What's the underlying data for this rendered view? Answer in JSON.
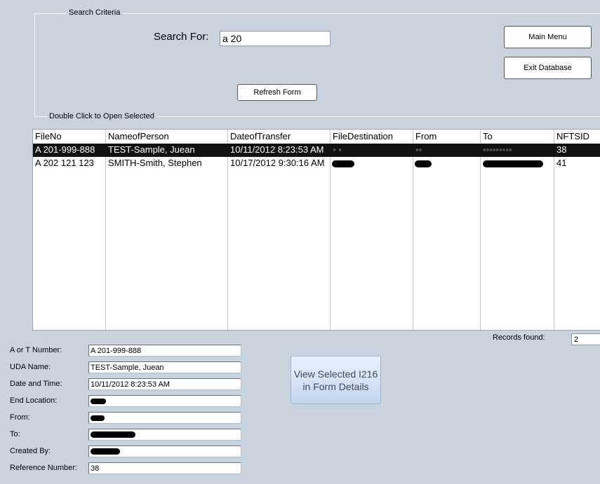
{
  "search": {
    "group_title": "Search Criteria",
    "label": "Search For:",
    "value": "a 20",
    "refresh_label": "Refresh Form"
  },
  "buttons": {
    "main_menu": "Main Menu",
    "exit_database": "Exit Database"
  },
  "list": {
    "caption": "Double Click to Open Selected",
    "columns": [
      "FileNo",
      "NameofPerson",
      "DateofTransfer",
      "FileDestination",
      "From",
      "To",
      "NFTSID"
    ],
    "rows": [
      {
        "fileno": "A 201-999-888",
        "name": "TEST-Sample, Juean",
        "date": "10/11/2012 8:23:53 AM",
        "destination": "[redacted]",
        "from": "[redacted]",
        "to": "[redacted]",
        "nftsid": "38",
        "selected": true
      },
      {
        "fileno": "A 202 121 123",
        "name": "SMITH-Smith, Stephen",
        "date": "10/17/2012 9:30:16 AM",
        "destination": "[redacted]",
        "from": "[redacted]",
        "to": "[redacted]",
        "nftsid": "41",
        "selected": false
      }
    ]
  },
  "records": {
    "label": "Records found:",
    "value": "2"
  },
  "details": {
    "a_or_t_label": "A or T Number:",
    "a_or_t_value": "A 201-999-888",
    "uda_label": "UDA Name:",
    "uda_value": "TEST-Sample, Juean",
    "datetime_label": "Date and Time:",
    "datetime_value": "10/11/2012 8:23:53 AM",
    "end_location_label": "End Location:",
    "from_label": "From:",
    "to_label": "To:",
    "created_by_label": "Created By:",
    "reference_label": "Reference Number:",
    "reference_value": "38"
  },
  "view_button": {
    "line1": "View Selected I216",
    "line2": "in Form Details"
  }
}
